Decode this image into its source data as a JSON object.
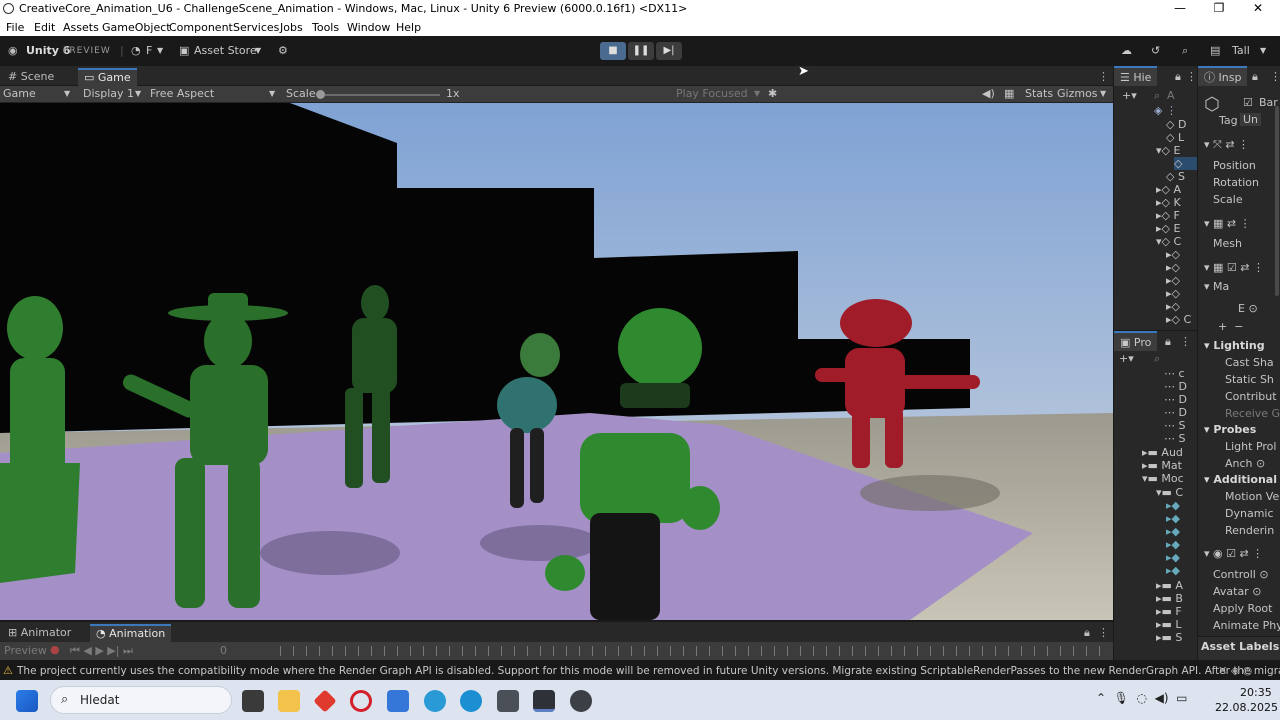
{
  "window": {
    "title": "CreativeCore_Animation_U6 - ChallengeScene_Animation - Windows, Mac, Linux - Unity 6 Preview (6000.0.16f1) <DX11>"
  },
  "menu": [
    "File",
    "Edit",
    "Assets",
    "GameObject",
    "Component",
    "Services",
    "Jobs",
    "Tools",
    "Window",
    "Help"
  ],
  "toolbar": {
    "unity_label": "Unity 6",
    "preview_label": "PREVIEW",
    "account": "F",
    "asset_store": "Asset Store",
    "layout": "Tall"
  },
  "tabs": {
    "scene": "Scene",
    "game": "Game"
  },
  "gamebar": {
    "mode": "Game",
    "display": "Display 1",
    "aspect": "Free Aspect",
    "scale_label": "Scale",
    "scale_value": "1x",
    "play_focused": "Play Focused",
    "stats": "Stats",
    "gizmos": "Gizmos"
  },
  "hierarchy": {
    "tab": "Hie",
    "search": "A"
  },
  "project": {
    "tab": "Pro",
    "folders": [
      "Aud",
      "Mat",
      "Moc"
    ]
  },
  "inspector": {
    "tab": "Insp",
    "object_name": "Bar",
    "tag_label": "Tag",
    "tag_value": "Un",
    "transform": [
      "Position",
      "Rotation",
      "Scale"
    ],
    "mesh": "Mesh",
    "materials": "Ma",
    "material_item": "E",
    "lighting": "Lighting",
    "lighting_items": [
      "Cast Sha",
      "Static Sh",
      "Contribut",
      "Receive G"
    ],
    "probes": "Probes",
    "probes_items": [
      "Light Prol",
      "Anch"
    ],
    "additional": "Additional S",
    "additional_items": [
      "Motion Ve",
      "Dynamic",
      "Renderin"
    ],
    "animator_items": [
      "Controll",
      "Avatar",
      "Apply Root",
      "Animate Phy"
    ],
    "asset_labels": "Asset Labels"
  },
  "bottom": {
    "animator_tab": "Animator",
    "animation_tab": "Animation",
    "preview": "Preview",
    "frame": "0"
  },
  "status": {
    "message": "The project currently uses the compatibility mode where the Render Graph API is disabled. Support for this mode will be removed in future Unity versions. Migrate existing ScriptableRenderPasses to the new RenderGraph API. After the migration, c"
  },
  "taskbar": {
    "search": "Hledat",
    "time": "20:35",
    "date": "22.08.2025"
  },
  "colors": {
    "accent": "#3a79bb",
    "floor": "#a08cc4",
    "sky": "#8fb0dc",
    "characters": "#2e8a2e",
    "red_character": "#b01e2a"
  }
}
